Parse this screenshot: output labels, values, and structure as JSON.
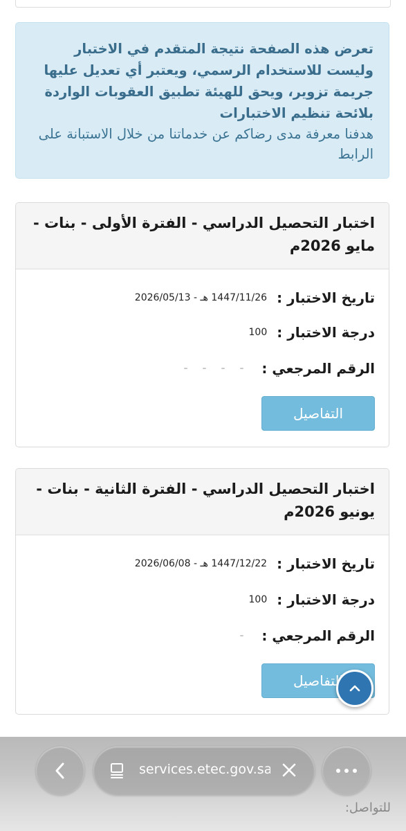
{
  "notice": {
    "bold_text": "تعرض هذه الصفحة نتيجة المتقدم في الاختبار وليست للاستخدام الرسمي، ويعتبر أي تعديل عليها جريمة تزوير، ويحق للهيئة تطبيق العقوبات الواردة بلائحة تنظيم الاختبارات",
    "normal_text": "هدفنا معرفة مدى رضاكم عن خدماتنا من خلال الاستبانة على الرابط"
  },
  "results": [
    {
      "title": "اختبار التحصيل الدراسي - الفترة الأولى - بنات - مايو 2026م",
      "date_label": "تاريخ الاختبار :",
      "date_value": "1447/11/26 هـ - 2026/05/13",
      "score_label": "درجة الاختبار :",
      "score_value": "100",
      "ref_label": "الرقم المرجعي :",
      "details_label": "التفاصيل"
    },
    {
      "title": "اختبار التحصيل الدراسي - الفترة الثانية - بنات - يونيو 2026م",
      "date_label": "تاريخ الاختبار :",
      "date_value": "1447/12/22 هـ - 2026/06/08",
      "score_label": "درجة الاختبار :",
      "score_value": "100",
      "ref_label": "الرقم المرجعي :",
      "details_label": "التفاصيل"
    }
  ],
  "footer": {
    "contact_label": "للتواصل:"
  },
  "browser": {
    "url": "services.etec.gov.sa"
  },
  "colors": {
    "notice_bg": "#d9ecf5",
    "notice_text": "#3a6d8c",
    "button": "#74bcdd",
    "scroll_top": "#2f75b1"
  },
  "icons": {
    "scroll_top": "chevron-up-icon",
    "back": "chevron-left-icon",
    "tabs": "tabs-icon",
    "close": "close-icon",
    "more": "more-horizontal-icon"
  }
}
